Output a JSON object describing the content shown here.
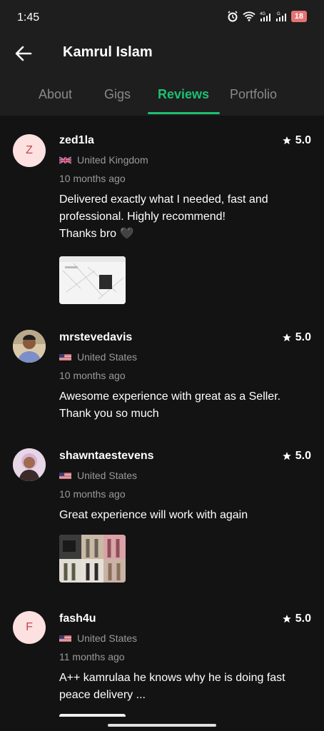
{
  "status": {
    "time": "1:45",
    "battery": "18",
    "icons": [
      "alarm-icon",
      "wifi-icon",
      "signal-4g-icon",
      "signal-icon",
      "battery-icon"
    ]
  },
  "header": {
    "title": "Kamrul Islam",
    "back_icon": "arrow-left-icon"
  },
  "tabs": [
    {
      "label": "About",
      "active": false
    },
    {
      "label": "Gigs",
      "active": false
    },
    {
      "label": "Reviews",
      "active": true
    },
    {
      "label": "Portfolio",
      "active": false
    }
  ],
  "colors": {
    "accent": "#1dbf73",
    "background": "#131313"
  },
  "reviews": [
    {
      "avatar_letter": "Z",
      "username": "zed1la",
      "rating": "5.0",
      "country": "United Kingdom",
      "flag": "uk-flag-icon",
      "time_ago": "10 months ago",
      "text": [
        "Delivered exactly what I needed, fast and",
        "professional. Highly recommend!",
        "Thanks bro 🖤"
      ],
      "has_image": true
    },
    {
      "avatar_letter": "",
      "username": "mrstevedavis",
      "rating": "5.0",
      "country": "United States",
      "flag": "us-flag-icon",
      "time_ago": "10 months ago",
      "text": [
        "Awesome experience with great as a Seller.",
        "Thank you so much"
      ],
      "has_image": false
    },
    {
      "avatar_letter": "",
      "username": "shawntaestevens",
      "rating": "5.0",
      "country": "United States",
      "flag": "us-flag-icon",
      "time_ago": "10 months ago",
      "text": [
        "Great experience will work with again"
      ],
      "has_image": true
    },
    {
      "avatar_letter": "F",
      "username": "fash4u",
      "rating": "5.0",
      "country": "United States",
      "flag": "us-flag-icon",
      "time_ago": "11 months ago",
      "text": [
        "A++ kamrulaa  he knows why he is doing fast",
        "peace delivery ..."
      ],
      "has_image": true
    }
  ]
}
